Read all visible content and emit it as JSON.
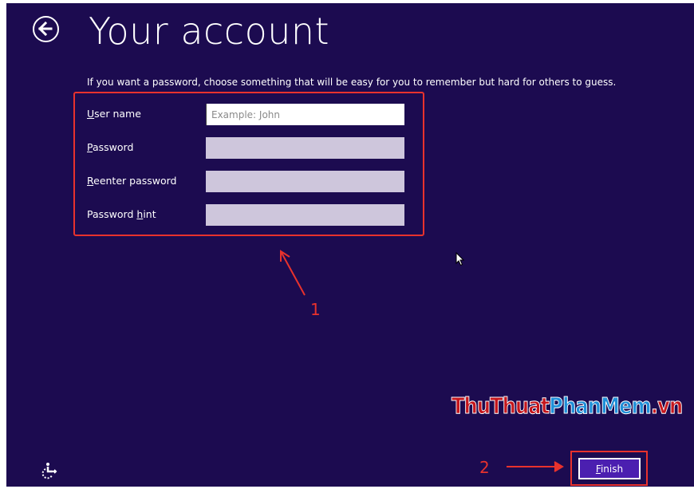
{
  "header": {
    "title": "Your account",
    "back_icon": "arrow-left-circle-icon"
  },
  "form": {
    "instructions": "If you want a password, choose something that will be easy for you to remember but hard for others to guess.",
    "fields": [
      {
        "label_key": "U",
        "label_rest": "ser name",
        "value": "",
        "placeholder": "Example: John"
      },
      {
        "label_key": "P",
        "label_rest": "assword",
        "value": "",
        "placeholder": ""
      },
      {
        "label_key": "R",
        "label_rest": "eenter password",
        "value": "",
        "placeholder": ""
      },
      {
        "label_pre": "Password ",
        "label_key": "h",
        "label_rest": "int",
        "value": "",
        "placeholder": ""
      }
    ]
  },
  "footer": {
    "accessibility_icon": "ease-of-access-icon",
    "finish_key": "F",
    "finish_rest": "inish"
  },
  "annotations": {
    "step1": "1",
    "step2": "2",
    "color": "#e8322d"
  },
  "watermark": {
    "part1": "ThuThuat",
    "part2": "PhanMem",
    "part3": ".vn"
  },
  "colors": {
    "background": "#1c0b50",
    "accent": "#4b1fb0",
    "input_disabled": "#cec6dc"
  }
}
